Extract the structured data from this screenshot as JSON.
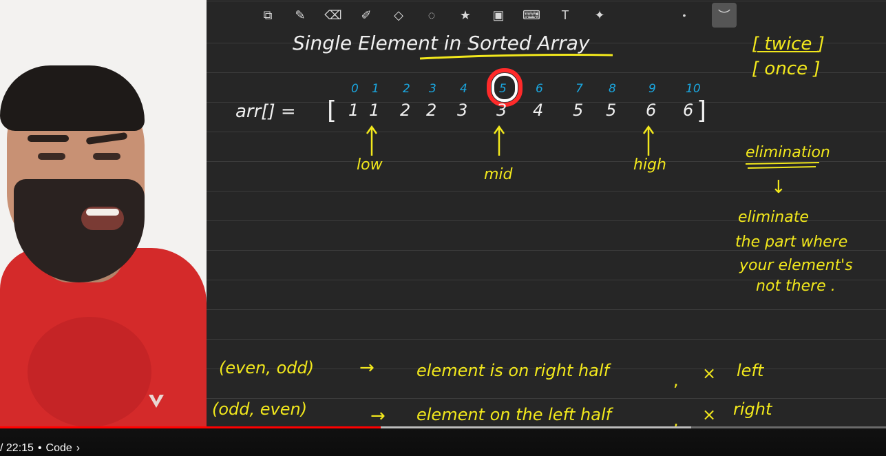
{
  "player": {
    "time_display": "/ 22:15",
    "separator": "•",
    "chapter_label": "Code",
    "chapter_chevron": "›",
    "progress_played_fraction": 0.43,
    "progress_buffered_fraction": 0.78
  },
  "toolbar": {
    "tools": [
      {
        "name": "lasso-image-tool-icon",
        "glyph": "⧉"
      },
      {
        "name": "pen-tool-icon",
        "glyph": "✎"
      },
      {
        "name": "eraser-tool-icon",
        "glyph": "⌫"
      },
      {
        "name": "highlighter-tool-icon",
        "glyph": "✐"
      },
      {
        "name": "shapes-tool-icon",
        "glyph": "◇"
      },
      {
        "name": "lasso-tool-icon",
        "glyph": "◌"
      },
      {
        "name": "sticker-tool-icon",
        "glyph": "★"
      },
      {
        "name": "image-tool-icon",
        "glyph": "▣"
      },
      {
        "name": "keyboard-tool-icon",
        "glyph": "⌨"
      },
      {
        "name": "text-tool-icon",
        "glyph": "T"
      },
      {
        "name": "laser-pointer-tool-icon",
        "glyph": "✦"
      },
      {
        "name": "pen-size-dot-icon",
        "glyph": "•"
      },
      {
        "name": "pen-stroke-preview-icon",
        "glyph": "︶"
      }
    ]
  },
  "board": {
    "title": "Single Element in Sorted Array",
    "note_top_right": [
      "[ twice ]",
      "[ once ]"
    ],
    "array_label": "arr[] =",
    "indices": [
      "0",
      "1",
      "2",
      "3",
      "4",
      "5",
      "6",
      "7",
      "8",
      "9",
      "10"
    ],
    "highlighted_index": "5",
    "values": [
      "1",
      "1",
      "2",
      "2",
      "3",
      "3",
      "4",
      "5",
      "5",
      "6",
      "6"
    ],
    "pointers": [
      {
        "label": "low",
        "index": 1
      },
      {
        "label": "mid",
        "index": 5
      },
      {
        "label": "high",
        "index": 9
      }
    ],
    "elimination": {
      "heading": "elimination",
      "arrow": "↓",
      "lines": [
        "eliminate",
        "the part where",
        "your element's",
        "not there ."
      ]
    },
    "rules": [
      {
        "pair": "(even, odd)",
        "arrow": "→",
        "text": "element is on right half",
        "cross": "×",
        "cross_text": "left"
      },
      {
        "pair": "(odd, even)",
        "arrow": "→",
        "text": "element on the left half",
        "cross": "×",
        "cross_text": "right"
      }
    ],
    "colors": {
      "ink_yellow": "#f2e81c",
      "ink_white": "#f0f0f0",
      "ink_cyan": "#1aa7e0",
      "highlight_red": "#ff2a2a",
      "board_bg": "#262626"
    }
  }
}
